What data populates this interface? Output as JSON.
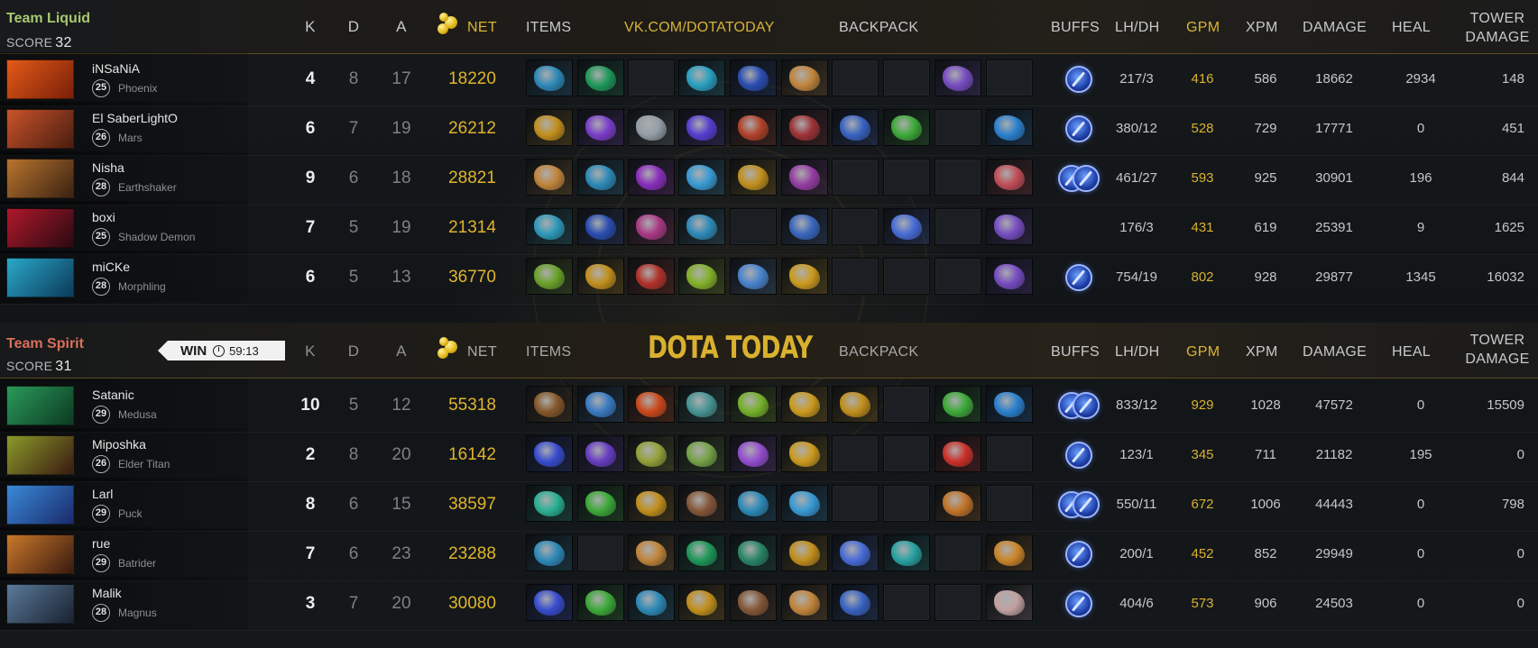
{
  "colors": {
    "accent_gold": "#d9b534",
    "radiant_team": "#a7c971",
    "dire_team": "#d8705a",
    "buff_blue": "#3f6fe0"
  },
  "headers": {
    "k": "K",
    "d": "D",
    "a": "A",
    "net": "NET",
    "items": "ITEMS",
    "backpack": "BACKPACK",
    "buffs": "BUFFS",
    "lhdh": "LH/DH",
    "gpm": "GPM",
    "xpm": "XPM",
    "damage": "DAMAGE",
    "heal": "HEAL",
    "tower_l1": "TOWER",
    "tower_l2": "DAMAGE",
    "watermark_top": "VK.COM/DOTATODAY",
    "watermark_mid": "DOTA TODAY"
  },
  "result": {
    "label": "WIN",
    "time": "59:13",
    "icon": "clock-icon"
  },
  "teams": [
    {
      "name": "Team Liquid",
      "score_label": "SCORE",
      "score": "32",
      "players": [
        {
          "name": "iNSaNiA",
          "level": "25",
          "hero": "Phoenix",
          "k": "4",
          "d": "8",
          "a": "17",
          "net": "18220",
          "items": [
            "#2f8fbf",
            "#1f9e5c",
            "",
            "#2aa6c8",
            "#2a4fb8",
            "#c98a3d"
          ],
          "backpack": [
            "",
            "",
            "#7b4fc9",
            ""
          ],
          "buffs": 1,
          "lhdh": "217/3",
          "gpm": "416",
          "xpm": "586",
          "damage": "18662",
          "heal": "2934",
          "tower": "148",
          "portrait": [
            "#e35a17",
            "#7a1f0a"
          ]
        },
        {
          "name": "El SaberLightO",
          "level": "26",
          "hero": "Mars",
          "k": "6",
          "d": "7",
          "a": "19",
          "net": "26212",
          "items": [
            "#c9941c",
            "#7f3fd1",
            "#9aa4ad",
            "#5a3fd8",
            "#b8432a",
            "#a33338"
          ],
          "backpack": [
            "#3a66c9",
            "#3fb03a",
            "",
            "#2c85d6"
          ],
          "buffs": 1,
          "lhdh": "380/12",
          "gpm": "528",
          "xpm": "729",
          "damage": "17771",
          "heal": "0",
          "tower": "451",
          "portrait": [
            "#c9532a",
            "#4a1d10"
          ]
        },
        {
          "name": "Nisha",
          "level": "28",
          "hero": "Earthshaker",
          "k": "9",
          "d": "6",
          "a": "18",
          "net": "28821",
          "items": [
            "#c98a3d",
            "#2f8fbf",
            "#8f2fc4",
            "#3aa0dd",
            "#c9941c",
            "#9a3fa8"
          ],
          "backpack": [
            "",
            "",
            "",
            "#c94f5a"
          ],
          "buffs": 2,
          "lhdh": "461/27",
          "gpm": "593",
          "xpm": "925",
          "damage": "30901",
          "heal": "196",
          "tower": "844",
          "portrait": [
            "#b8742e",
            "#3b2212"
          ]
        },
        {
          "name": "boxi",
          "level": "25",
          "hero": "Shadow Demon",
          "k": "7",
          "d": "5",
          "a": "19",
          "net": "21314",
          "items": [
            "#2f9fc2",
            "#2a4fb8",
            "#b03a8a",
            "#2f8fbf",
            "",
            "#3a6ac4"
          ],
          "backpack": [
            "",
            "#4a6fe0",
            "",
            "#7b4fc9"
          ],
          "buffs": 0,
          "lhdh": "176/3",
          "gpm": "431",
          "xpm": "619",
          "damage": "25391",
          "heal": "9",
          "tower": "1625",
          "portrait": [
            "#b0182a",
            "#2a0a12"
          ]
        },
        {
          "name": "miCKe",
          "level": "28",
          "hero": "Morphling",
          "k": "6",
          "d": "5",
          "a": "13",
          "net": "36770",
          "items": [
            "#6ea82a",
            "#c9941c",
            "#b8322a",
            "#88b82a",
            "#4a88d6",
            "#d4a11e"
          ],
          "backpack": [
            "",
            "",
            "",
            "#7b4fc9"
          ],
          "buffs": 1,
          "lhdh": "754/19",
          "gpm": "802",
          "xpm": "928",
          "damage": "29877",
          "heal": "1345",
          "tower": "16032",
          "portrait": [
            "#2aa8c8",
            "#0c3a5a"
          ]
        }
      ]
    },
    {
      "name": "Team Spirit",
      "score_label": "SCORE",
      "score": "31",
      "players": [
        {
          "name": "Satanic",
          "level": "29",
          "hero": "Medusa",
          "k": "10",
          "d": "5",
          "a": "12",
          "net": "55318",
          "items": [
            "#8a5a2a",
            "#3a7ec9",
            "#d44a1a",
            "#4a9a9a",
            "#7ab82a",
            "#d4a11e"
          ],
          "backpack": [
            "#c9941c",
            "",
            "#3fb03a",
            "#2c85d6"
          ],
          "buffs": 2,
          "lhdh": "833/12",
          "gpm": "929",
          "xpm": "1028",
          "damage": "47572",
          "heal": "0",
          "tower": "15509",
          "portrait": [
            "#2a9a5a",
            "#0c3a22"
          ]
        },
        {
          "name": "Miposhka",
          "level": "26",
          "hero": "Elder Titan",
          "k": "2",
          "d": "8",
          "a": "20",
          "net": "16142",
          "items": [
            "#3a4fd8",
            "#6a3fc9",
            "#9aa83a",
            "#7aa84a",
            "#9a4fd8",
            "#d4a11e"
          ],
          "backpack": [
            "",
            "",
            "#d4322a",
            ""
          ],
          "buffs": 1,
          "lhdh": "123/1",
          "gpm": "345",
          "xpm": "711",
          "damage": "21182",
          "heal": "195",
          "tower": "0",
          "portrait": [
            "#8a9a2a",
            "#3a1a12"
          ]
        },
        {
          "name": "Larl",
          "level": "29",
          "hero": "Puck",
          "k": "8",
          "d": "6",
          "a": "15",
          "net": "38597",
          "items": [
            "#2ab89a",
            "#3fb03a",
            "#c9941c",
            "#8a5a3a",
            "#2f8fbf",
            "#3aa0dd"
          ],
          "backpack": [
            "",
            "",
            "#c9782a",
            ""
          ],
          "buffs": 2,
          "lhdh": "550/11",
          "gpm": "672",
          "xpm": "1006",
          "damage": "44443",
          "heal": "0",
          "tower": "798",
          "portrait": [
            "#3a8ad8",
            "#1a2a6a"
          ]
        },
        {
          "name": "rue",
          "level": "29",
          "hero": "Batrider",
          "k": "7",
          "d": "6",
          "a": "23",
          "net": "23288",
          "items": [
            "#2f8fbf",
            "",
            "#c98a3d",
            "#1f9e5c",
            "#2a8a6a",
            "#c9941c"
          ],
          "backpack": [
            "#4a6fe0",
            "#2aa8a8",
            "",
            "#d48a2a"
          ],
          "buffs": 1,
          "lhdh": "200/1",
          "gpm": "452",
          "xpm": "852",
          "damage": "29949",
          "heal": "0",
          "tower": "0",
          "portrait": [
            "#c9782a",
            "#3a1a10"
          ]
        },
        {
          "name": "Malik",
          "level": "28",
          "hero": "Magnus",
          "k": "3",
          "d": "7",
          "a": "20",
          "net": "30080",
          "items": [
            "#3a4fd8",
            "#3fb03a",
            "#2f8fbf",
            "#c9941c",
            "#8a5a3a",
            "#c98a3d"
          ],
          "backpack": [
            "#3a66c9",
            "",
            "",
            "#c9a8a8"
          ],
          "buffs": 1,
          "lhdh": "404/6",
          "gpm": "573",
          "xpm": "906",
          "damage": "24503",
          "heal": "0",
          "tower": "0",
          "portrait": [
            "#5a7a9a",
            "#1a2230"
          ]
        }
      ]
    }
  ]
}
